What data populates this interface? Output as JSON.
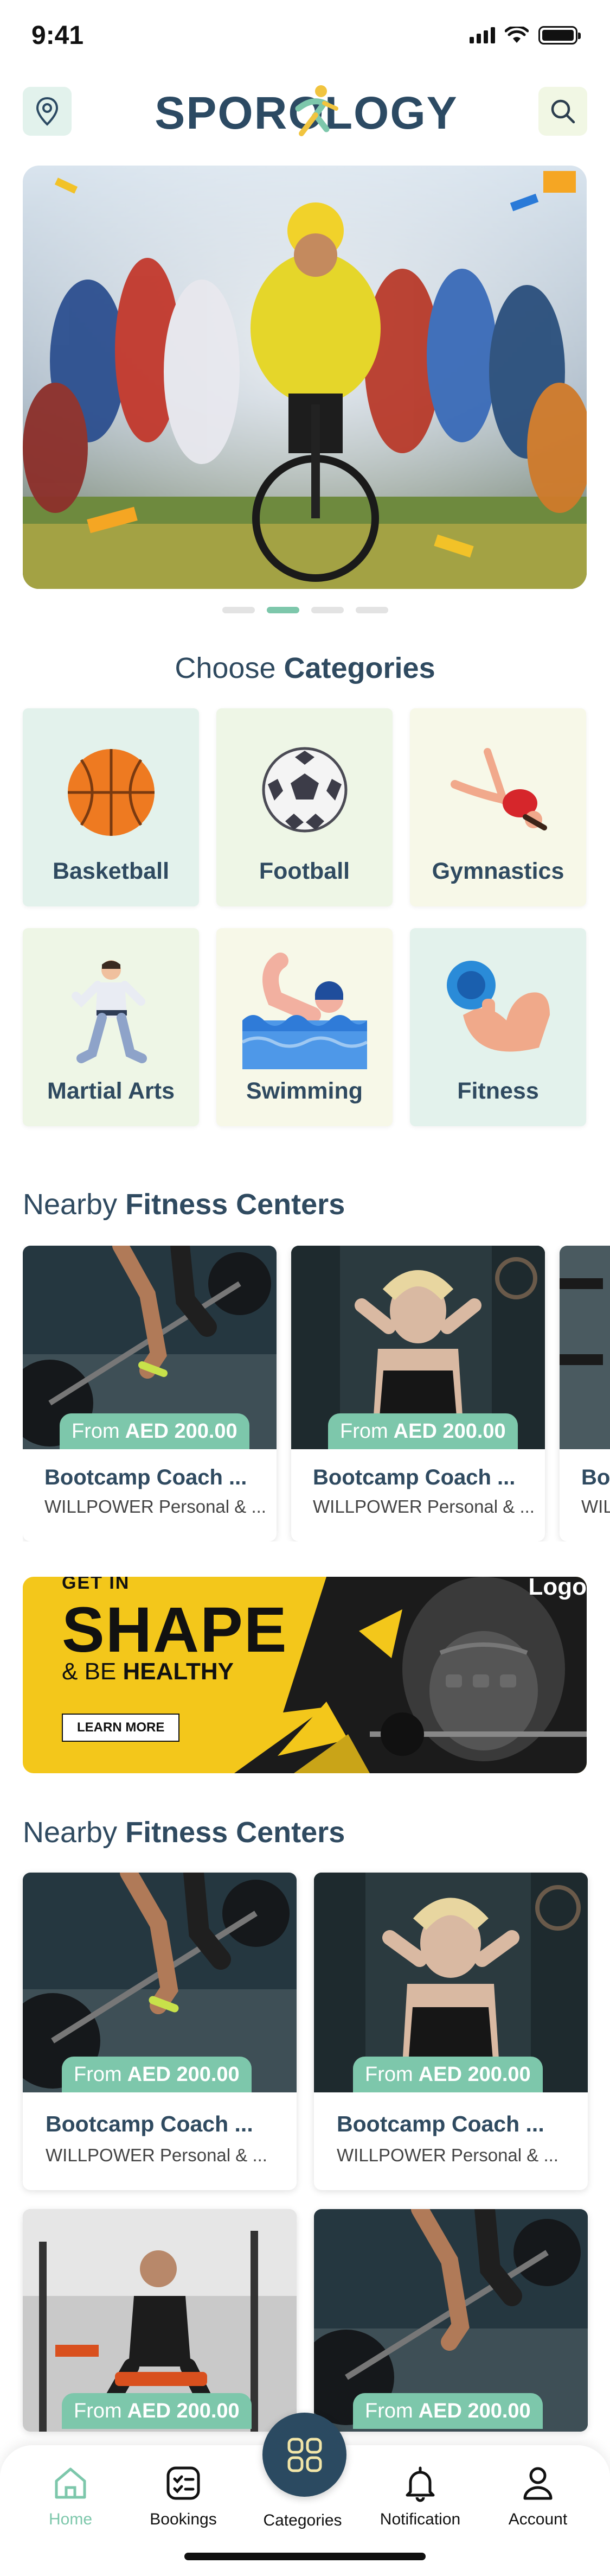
{
  "status_bar": {
    "time": "9:41"
  },
  "header": {
    "logo": "SPOROLOGY"
  },
  "hero": {
    "slides": 4,
    "active_slide": 2
  },
  "categories": {
    "title_light": "Choose",
    "title_bold": "Categories",
    "items": [
      {
        "label": "Basketball",
        "bg": "#e3f2ec",
        "icon": "basketball-icon"
      },
      {
        "label": "Football",
        "bg": "#eef6e6",
        "icon": "football-icon"
      },
      {
        "label": "Gymnastics",
        "bg": "#f7f8e8",
        "icon": "gymnastics-icon"
      },
      {
        "label": "Martial Arts",
        "bg": "#eef6e6",
        "icon": "martial-arts-icon"
      },
      {
        "label": "Swimming",
        "bg": "#f7f8e8",
        "icon": "swimming-icon"
      },
      {
        "label": "Fitness",
        "bg": "#e3f2ec",
        "icon": "fitness-icon"
      }
    ]
  },
  "nearby_1": {
    "title_light": "Nearby",
    "title_bold": "Fitness Centers",
    "cards": [
      {
        "price_prefix": "From",
        "price": "AED 200.00",
        "title": "Bootcamp Coach ...",
        "subtitle": "WILLPOWER Personal & ..."
      },
      {
        "price_prefix": "From",
        "price": "AED 200.00",
        "title": "Bootcamp Coach ...",
        "subtitle": "WILLPOWER Personal & ..."
      },
      {
        "price_prefix": "",
        "price": "",
        "title": "Boo",
        "subtitle": "WIL"
      }
    ]
  },
  "banner": {
    "line1": "GET IN",
    "line2": "SHAPE",
    "line3_light": "& BE",
    "line3_bold": "HEALTHY",
    "button": "LEARN MORE",
    "logo": "Logo"
  },
  "nearby_2": {
    "title_light": "Nearby",
    "title_bold": "Fitness Centers",
    "cards": [
      {
        "price_prefix": "From",
        "price": "AED 200.00",
        "title": "Bootcamp Coach ...",
        "subtitle": "WILLPOWER Personal & ..."
      },
      {
        "price_prefix": "From",
        "price": "AED 200.00",
        "title": "Bootcamp Coach ...",
        "subtitle": "WILLPOWER Personal & ..."
      },
      {
        "price_prefix": "From",
        "price": "AED 200.00",
        "title": "",
        "subtitle": ""
      },
      {
        "price_prefix": "From",
        "price": "AED 200.00",
        "title": "",
        "subtitle": ""
      }
    ]
  },
  "tabbar": {
    "home": "Home",
    "bookings": "Bookings",
    "categories": "Categories",
    "notification": "Notification",
    "account": "Account",
    "active_color": "#7dc7ab",
    "fab_color": "#2b4a61"
  }
}
